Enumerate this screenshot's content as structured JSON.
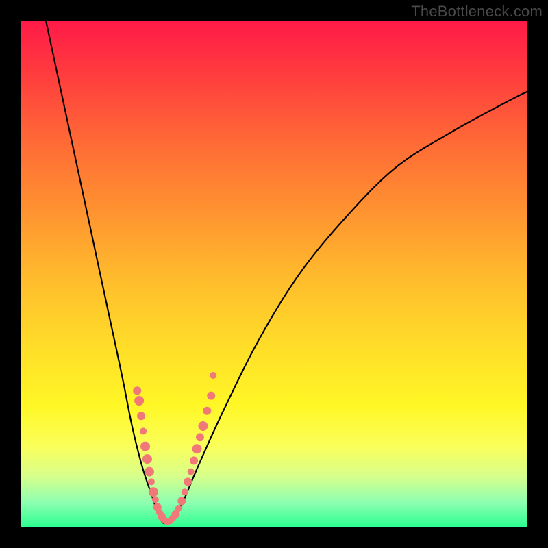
{
  "watermark": "TheBottleneck.com",
  "chart_data": {
    "type": "line",
    "title": "",
    "xlabel": "",
    "ylabel": "",
    "xlim": [
      0,
      100
    ],
    "ylim": [
      0,
      100
    ],
    "series": [
      {
        "name": "bottleneck-curve",
        "x": [
          5,
          8,
          11,
          14,
          17,
          20,
          22,
          24,
          26,
          27,
          28,
          29,
          30,
          32,
          35,
          40,
          47,
          55,
          64,
          74,
          85,
          96,
          100
        ],
        "y": [
          100,
          86,
          72,
          58,
          44,
          30,
          20,
          12,
          6,
          3,
          1,
          1,
          2,
          5,
          12,
          23,
          37,
          50,
          61,
          71,
          78,
          84,
          86
        ]
      }
    ],
    "markers": {
      "name": "highlight-dots",
      "color": "#f07878",
      "points": [
        {
          "x": 23.0,
          "y": 27.0,
          "r": 6
        },
        {
          "x": 23.4,
          "y": 25.0,
          "r": 7
        },
        {
          "x": 23.8,
          "y": 22.0,
          "r": 6
        },
        {
          "x": 24.2,
          "y": 19.0,
          "r": 5
        },
        {
          "x": 24.6,
          "y": 16.0,
          "r": 7
        },
        {
          "x": 25.0,
          "y": 13.5,
          "r": 7
        },
        {
          "x": 25.4,
          "y": 11.0,
          "r": 7
        },
        {
          "x": 25.8,
          "y": 9.0,
          "r": 5
        },
        {
          "x": 26.2,
          "y": 7.0,
          "r": 7
        },
        {
          "x": 26.6,
          "y": 5.5,
          "r": 5
        },
        {
          "x": 27.0,
          "y": 4.0,
          "r": 6
        },
        {
          "x": 27.4,
          "y": 3.0,
          "r": 5
        },
        {
          "x": 27.8,
          "y": 2.2,
          "r": 6
        },
        {
          "x": 28.2,
          "y": 1.6,
          "r": 5
        },
        {
          "x": 28.6,
          "y": 1.3,
          "r": 5
        },
        {
          "x": 29.0,
          "y": 1.2,
          "r": 5
        },
        {
          "x": 29.5,
          "y": 1.3,
          "r": 5
        },
        {
          "x": 30.0,
          "y": 1.8,
          "r": 5
        },
        {
          "x": 30.6,
          "y": 2.6,
          "r": 6
        },
        {
          "x": 31.2,
          "y": 3.8,
          "r": 5
        },
        {
          "x": 31.8,
          "y": 5.2,
          "r": 6
        },
        {
          "x": 32.4,
          "y": 7.0,
          "r": 5
        },
        {
          "x": 33.0,
          "y": 9.0,
          "r": 6
        },
        {
          "x": 33.6,
          "y": 11.0,
          "r": 5
        },
        {
          "x": 34.2,
          "y": 13.2,
          "r": 6
        },
        {
          "x": 34.8,
          "y": 15.5,
          "r": 7
        },
        {
          "x": 35.4,
          "y": 17.8,
          "r": 6
        },
        {
          "x": 36.0,
          "y": 20.0,
          "r": 7
        },
        {
          "x": 36.8,
          "y": 23.0,
          "r": 6
        },
        {
          "x": 37.6,
          "y": 26.0,
          "r": 6
        },
        {
          "x": 38.0,
          "y": 30.0,
          "r": 5
        }
      ]
    }
  }
}
